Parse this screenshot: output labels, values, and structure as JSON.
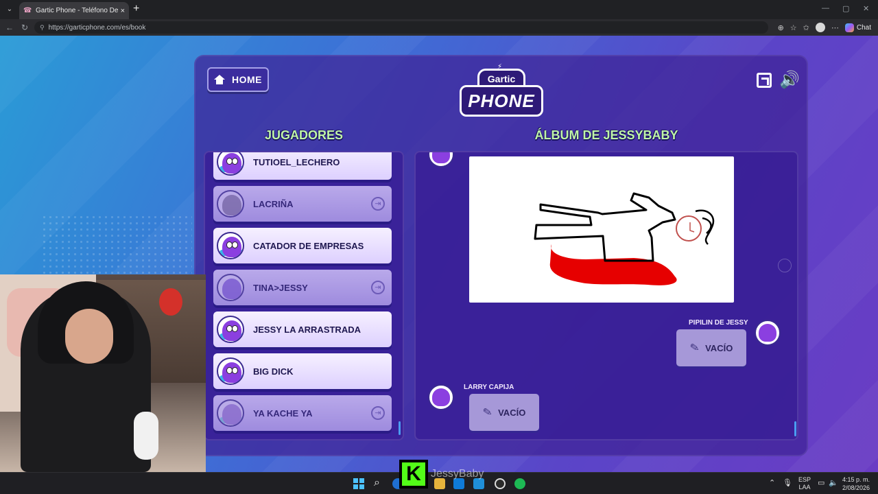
{
  "browser": {
    "tab_title": "Gartic Phone - Teléfono Descomp",
    "tab_close": "×",
    "new_tab": "+",
    "url": "https://garticphone.com/es/book",
    "chat_label": "Chat"
  },
  "game": {
    "home_label": "HOME",
    "logo_top": "Gartic",
    "logo_bottom": "PHONE",
    "players_title": "JUGADORES",
    "album_title": "ÁLBUM DE JESSYBABY",
    "players": [
      {
        "name": "TUTIOEL_LECHERO",
        "state": "active"
      },
      {
        "name": "LACRIÑA",
        "state": "left"
      },
      {
        "name": "CATADOR DE EMPRESAS",
        "state": "active"
      },
      {
        "name": "TINA>JESSY",
        "state": "left"
      },
      {
        "name": "JESSY LA ARRASTRADA",
        "state": "active"
      },
      {
        "name": "BIG DICK",
        "state": "active"
      },
      {
        "name": "YA KACHE YA",
        "state": "left"
      }
    ],
    "album": {
      "entries": [
        {
          "author": "PIPILIN DE JESSY",
          "content": "VACÍO"
        },
        {
          "author": "LARRY CAPIJA",
          "content": "VACÍO"
        }
      ]
    }
  },
  "overlay": {
    "streamer_name": "JessyBaby",
    "kick_letter": "K"
  },
  "taskbar": {
    "lang_top": "ESP",
    "lang_bottom": "LAA",
    "time": "4:15 p. m.",
    "date": "2/08/2026"
  },
  "colors": {
    "section_title": "#bff5a8",
    "panel_bg": "#3e2296",
    "kick_green": "#53fc18",
    "blood_red": "#e00000"
  }
}
